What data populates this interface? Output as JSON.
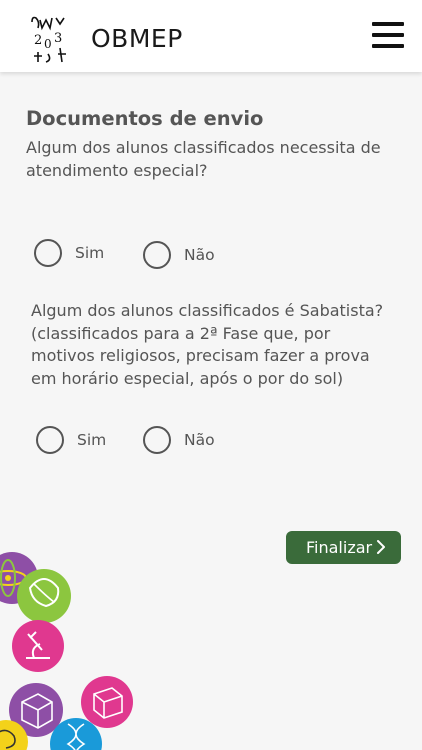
{
  "header": {
    "app_title": "OBMEP",
    "logo_text": "2017",
    "menu_icon": "hamburger-menu-icon"
  },
  "main": {
    "section_title": "Documentos de envio",
    "question1": {
      "text": "Algum dos alunos classificados necessita de atendimento especial?",
      "options": [
        {
          "label": "Sim",
          "selected": false
        },
        {
          "label": "Não",
          "selected": false
        }
      ]
    },
    "question2": {
      "text": "Algum dos alunos classificados é Sabatista? (classificados para a 2ª Fase que, por motivos religiosos, precisam fazer a prova em horário especial, após o por do sol)",
      "options": [
        {
          "label": "Sim",
          "selected": false
        },
        {
          "label": "Não",
          "selected": false
        }
      ]
    },
    "submit_label": "Finalizar",
    "submit_icon": "chevron-right-icon"
  },
  "colors": {
    "submit_button": "#3a6b3a",
    "background": "#f6f6f6",
    "header": "#ffffff",
    "deco_purple": "#8e4fa6",
    "deco_green": "#8cc63f",
    "deco_pink": "#e0388f",
    "deco_yellow": "#f3d21a",
    "deco_blue": "#1a9ad9"
  }
}
